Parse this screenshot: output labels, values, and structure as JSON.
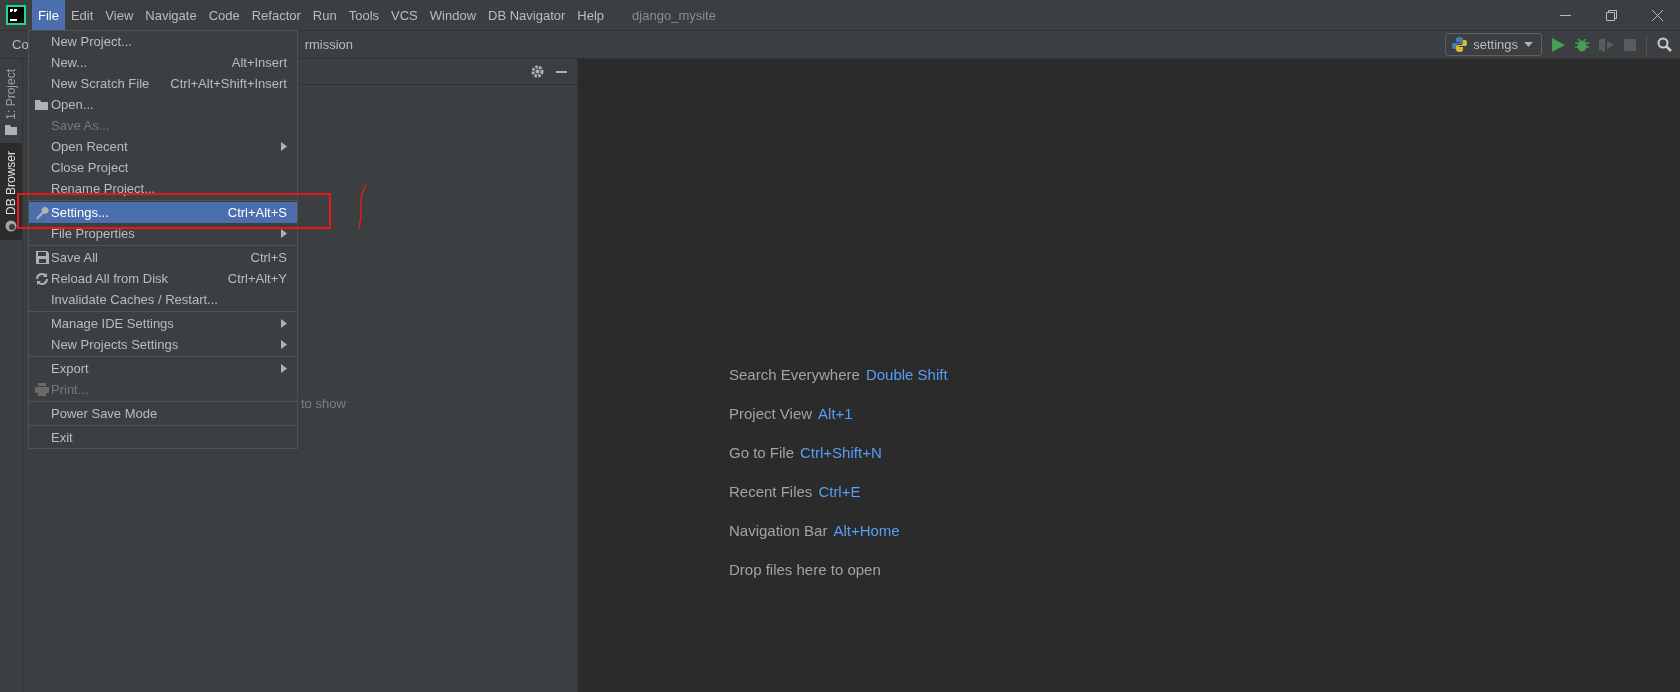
{
  "menu_bar": {
    "items": [
      {
        "label": "File",
        "selected": true
      },
      {
        "label": "Edit",
        "selected": false
      },
      {
        "label": "View",
        "selected": false
      },
      {
        "label": "Navigate",
        "selected": false
      },
      {
        "label": "Code",
        "selected": false
      },
      {
        "label": "Refactor",
        "selected": false
      },
      {
        "label": "Run",
        "selected": false
      },
      {
        "label": "Tools",
        "selected": false
      },
      {
        "label": "VCS",
        "selected": false
      },
      {
        "label": "Window",
        "selected": false
      },
      {
        "label": "DB Navigator",
        "selected": false
      },
      {
        "label": "Help",
        "selected": false
      }
    ],
    "project_title": "django_mysite"
  },
  "toolbar": {
    "breadcrumb": "Co",
    "tab": "rmission",
    "run_config": "settings"
  },
  "tool_stripe": [
    {
      "label": "1: Project",
      "selected": false
    },
    {
      "label": "DB Browser",
      "selected": true
    }
  ],
  "project_panel": {
    "empty_text": "to show"
  },
  "file_menu": [
    {
      "kind": "item",
      "label": "New Project...",
      "selected": false,
      "disabled": false
    },
    {
      "kind": "item",
      "label": "New...",
      "shortcut": "Alt+Insert",
      "selected": false,
      "disabled": false
    },
    {
      "kind": "item",
      "label": "New Scratch File",
      "shortcut": "Ctrl+Alt+Shift+Insert",
      "selected": false,
      "disabled": false
    },
    {
      "kind": "folder",
      "label": "Open...",
      "selected": false,
      "disabled": false
    },
    {
      "kind": "item",
      "label": "Save As...",
      "selected": false,
      "disabled": true
    },
    {
      "kind": "submenu",
      "label": "Open Recent",
      "selected": false,
      "disabled": false
    },
    {
      "kind": "item",
      "label": "Close Project",
      "selected": false,
      "disabled": false
    },
    {
      "kind": "item",
      "label": "Rename Project...",
      "selected": false,
      "disabled": false
    },
    {
      "kind": "separator"
    },
    {
      "kind": "wrench",
      "label": "Settings...",
      "shortcut": "Ctrl+Alt+S",
      "selected": true,
      "disabled": false
    },
    {
      "kind": "submenu",
      "label": "File Properties",
      "selected": false,
      "disabled": false
    },
    {
      "kind": "separator"
    },
    {
      "kind": "save",
      "label": "Save All",
      "shortcut": "Ctrl+S",
      "selected": false,
      "disabled": false
    },
    {
      "kind": "reload",
      "label": "Reload All from Disk",
      "shortcut": "Ctrl+Alt+Y",
      "selected": false,
      "disabled": false
    },
    {
      "kind": "item",
      "label": "Invalidate Caches / Restart...",
      "selected": false,
      "disabled": false
    },
    {
      "kind": "separator"
    },
    {
      "kind": "submenu",
      "label": "Manage IDE Settings",
      "selected": false,
      "disabled": false
    },
    {
      "kind": "submenu",
      "label": "New Projects Settings",
      "selected": false,
      "disabled": false
    },
    {
      "kind": "separator"
    },
    {
      "kind": "submenu",
      "label": "Export",
      "selected": false,
      "disabled": false
    },
    {
      "kind": "printer",
      "label": "Print...",
      "selected": false,
      "disabled": true
    },
    {
      "kind": "separator"
    },
    {
      "kind": "item",
      "label": "Power Save Mode",
      "selected": false,
      "disabled": false
    },
    {
      "kind": "separator"
    },
    {
      "kind": "item",
      "label": "Exit",
      "selected": false,
      "disabled": false
    }
  ],
  "editor_hints": [
    {
      "label": "Search Everywhere",
      "shortcut": "Double Shift"
    },
    {
      "label": "Project View",
      "shortcut": "Alt+1"
    },
    {
      "label": "Go to File",
      "shortcut": "Ctrl+Shift+N"
    },
    {
      "label": "Recent Files",
      "shortcut": "Ctrl+E"
    },
    {
      "label": "Navigation Bar",
      "shortcut": "Alt+Home"
    },
    {
      "label": "Drop files here to open"
    }
  ]
}
